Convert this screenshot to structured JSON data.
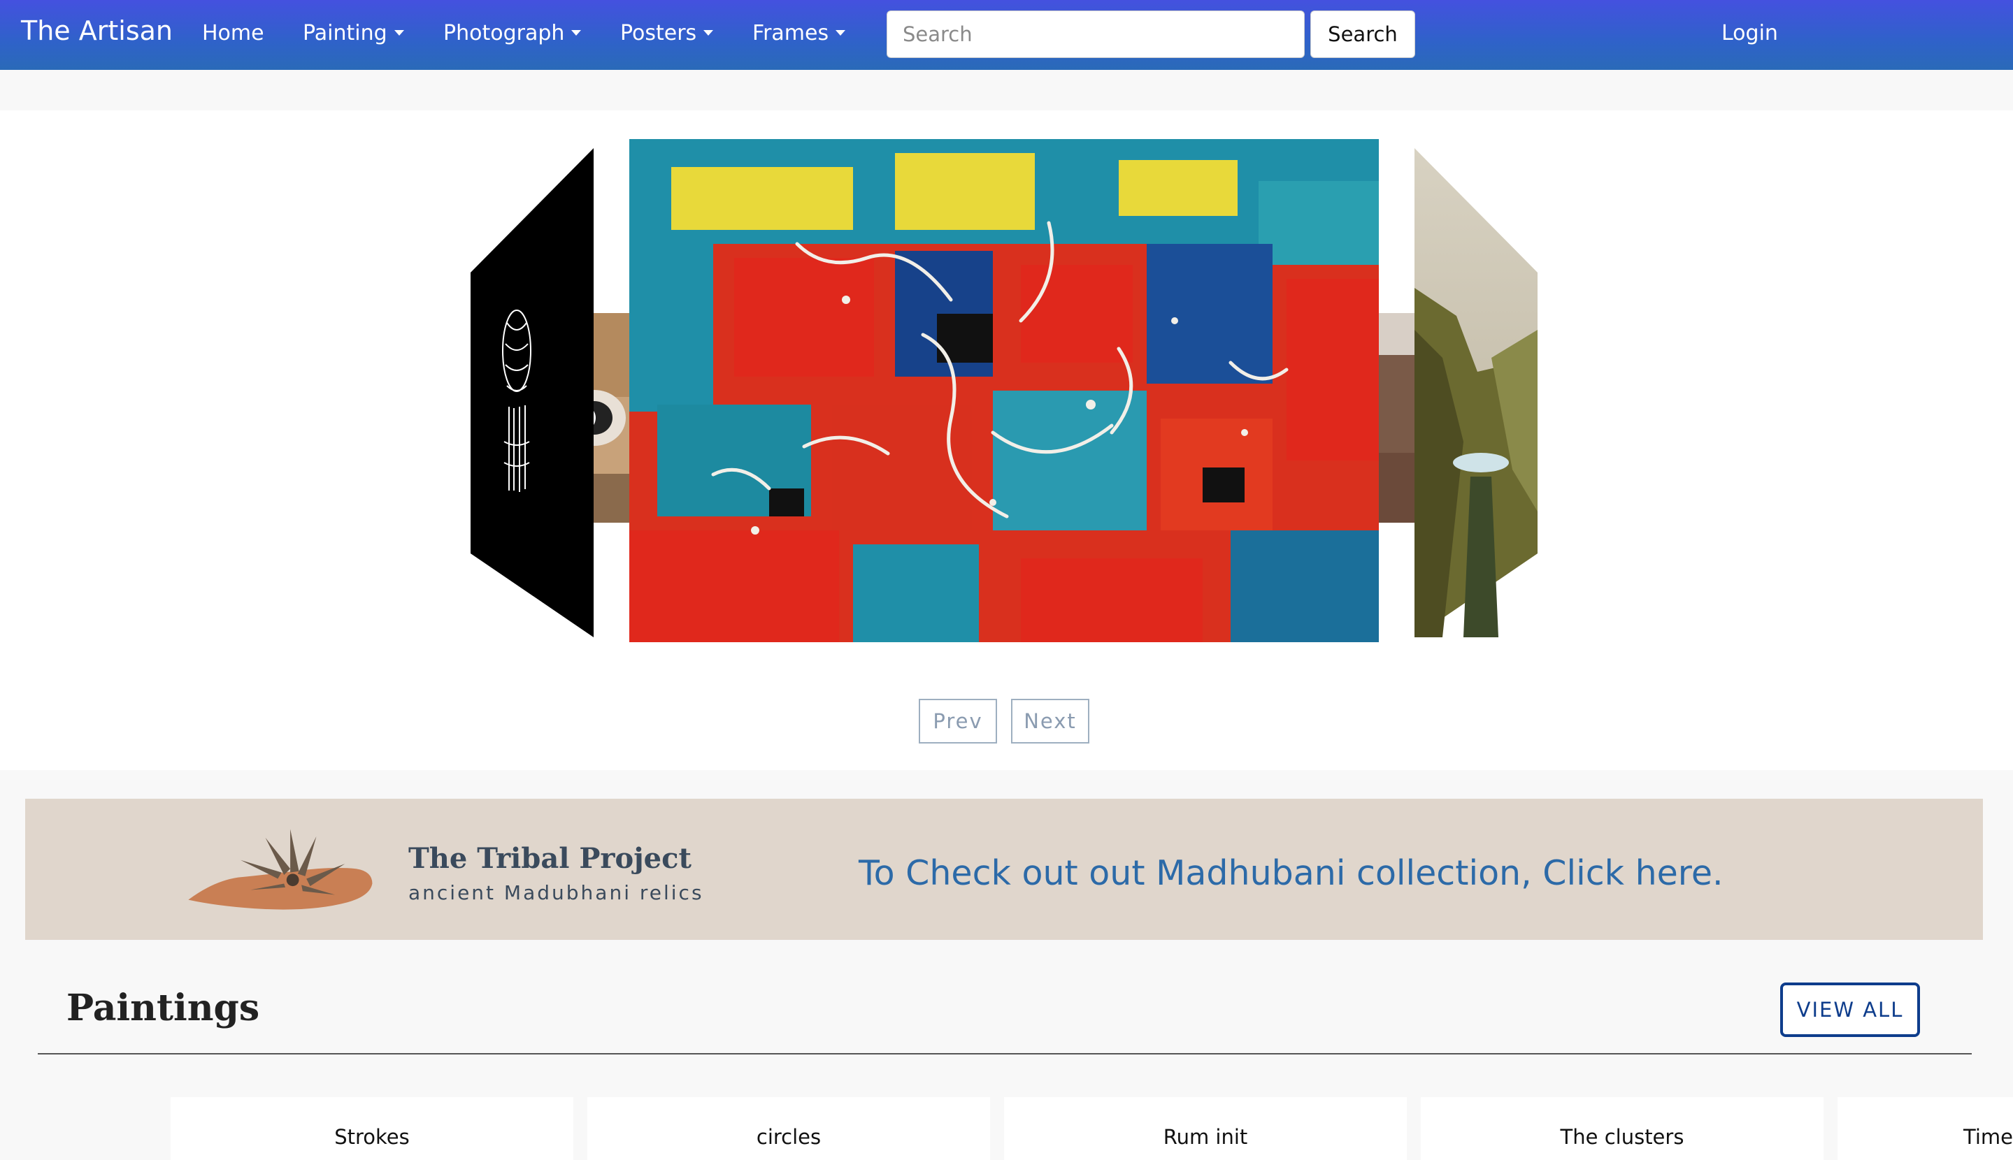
{
  "header": {
    "brand": "The Artisan",
    "nav": [
      {
        "label": "Home",
        "dropdown": false
      },
      {
        "label": "Painting",
        "dropdown": true
      },
      {
        "label": "Photograph",
        "dropdown": true
      },
      {
        "label": "Posters",
        "dropdown": true
      },
      {
        "label": "Frames",
        "dropdown": true
      }
    ],
    "search_placeholder": "Search",
    "search_value": "",
    "search_button": "Search",
    "login": "Login"
  },
  "carousel": {
    "prev_label": "Prev",
    "next_label": "Next"
  },
  "banner": {
    "title": "The Tribal Project",
    "subtitle": "ancient Madubhani relics",
    "link_text": "To Check out out Madhubani collection, Click here."
  },
  "paintings": {
    "title": "Paintings",
    "view_all": "VIEW ALL",
    "cards": [
      {
        "title": "Strokes"
      },
      {
        "title": "circles"
      },
      {
        "title": "Rum init"
      },
      {
        "title": "The clusters"
      },
      {
        "title": "Time"
      }
    ]
  },
  "colors": {
    "nav_gradient_start": "#4451df",
    "nav_gradient_end": "#2a6ab8",
    "banner_bg": "#e0d6cc",
    "banner_link": "#2c6aa8",
    "view_all_border": "#0e3d8c"
  }
}
